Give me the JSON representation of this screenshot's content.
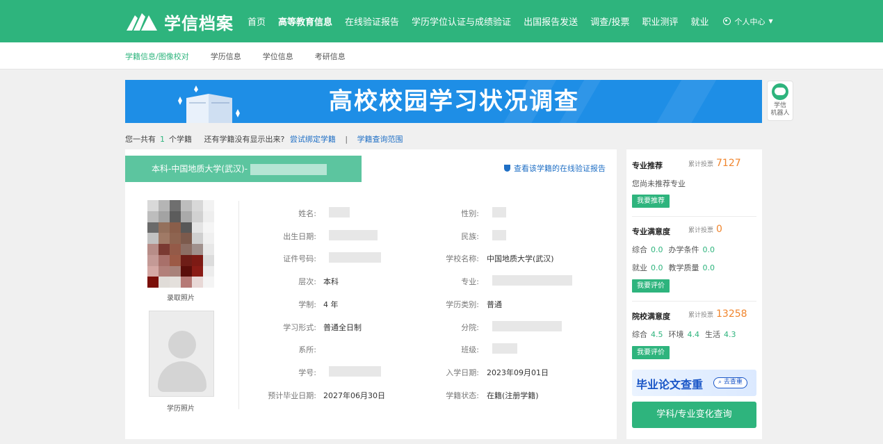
{
  "brand": {
    "name": "学信档案"
  },
  "nav": {
    "items": [
      {
        "label": "首页",
        "active": false
      },
      {
        "label": "高等教育信息",
        "active": true
      },
      {
        "label": "在线验证报告",
        "active": false
      },
      {
        "label": "学历学位认证与成绩验证",
        "active": false
      },
      {
        "label": "出国报告发送",
        "active": false
      },
      {
        "label": "调查/投票",
        "active": false
      },
      {
        "label": "职业测评",
        "active": false
      },
      {
        "label": "就业",
        "active": false
      }
    ],
    "user_center": "个人中心"
  },
  "subnav": {
    "items": [
      {
        "label": "学籍信息/图像校对",
        "active": true
      },
      {
        "label": "学历信息",
        "active": false
      },
      {
        "label": "学位信息",
        "active": false
      },
      {
        "label": "考研信息",
        "active": false
      }
    ]
  },
  "banner": {
    "title": "高校校园学习状况调查"
  },
  "robot": {
    "label_line1": "学信",
    "label_line2": "机器人"
  },
  "summary": {
    "prefix": "您一共有",
    "count": "1",
    "suffix": "个学籍",
    "missing_text": "还有学籍没有显示出来?",
    "bind_link": "尝试绑定学籍",
    "separator": "|",
    "scope_link": "学籍查询范围"
  },
  "record": {
    "tab_title": "本科-中国地质大学(武汉)-",
    "verify_link": "查看该学籍的在线验证报告",
    "admission_photo_label": "录取照片",
    "degree_photo_label": "学历照片",
    "fields_left": [
      {
        "label": "姓名:",
        "value": ""
      },
      {
        "label": "出生日期:",
        "value": ""
      },
      {
        "label": "证件号码:",
        "value": ""
      },
      {
        "label": "层次:",
        "value": "本科"
      },
      {
        "label": "学制:",
        "value": "4 年"
      },
      {
        "label": "学习形式:",
        "value": "普通全日制"
      },
      {
        "label": "系所:",
        "value": ""
      },
      {
        "label": "学号:",
        "value": ""
      },
      {
        "label": "预计毕业日期:",
        "value": "2027年06月30日"
      }
    ],
    "fields_right": [
      {
        "label": "性别:",
        "value": ""
      },
      {
        "label": "民族:",
        "value": ""
      },
      {
        "label": "学校名称:",
        "value": "中国地质大学(武汉)"
      },
      {
        "label": "专业:",
        "value": ""
      },
      {
        "label": "学历类别:",
        "value": "普通"
      },
      {
        "label": "分院:",
        "value": ""
      },
      {
        "label": "班级:",
        "value": ""
      },
      {
        "label": "入学日期:",
        "value": "2023年09月01日"
      },
      {
        "label": "学籍状态:",
        "value": "在籍(注册学籍)"
      }
    ]
  },
  "sidebar": {
    "major_recommend": {
      "title": "专业推荐",
      "votes_label": "累计投票",
      "votes": "7127",
      "text": "您尚未推荐专业",
      "button": "我要推荐"
    },
    "major_satisfaction": {
      "title": "专业满意度",
      "votes_label": "累计投票",
      "votes": "0",
      "scores": [
        {
          "label": "综合",
          "value": "0.0"
        },
        {
          "label": "办学条件",
          "value": "0.0"
        },
        {
          "label": "就业",
          "value": "0.0"
        },
        {
          "label": "教学质量",
          "value": "0.0"
        }
      ],
      "button": "我要评价"
    },
    "school_satisfaction": {
      "title": "院校满意度",
      "votes_label": "累计投票",
      "votes": "13258",
      "scores": [
        {
          "label": "综合",
          "value": "4.5"
        },
        {
          "label": "环境",
          "value": "4.4"
        },
        {
          "label": "生活",
          "value": "4.3"
        }
      ],
      "button": "我要评价"
    },
    "thesis_ad": {
      "title": "毕业论文查重",
      "search": "去查重"
    },
    "change_query": "学科/专业变化查询"
  },
  "colors": {
    "brand_green": "#2eb47d",
    "tab_green": "#5cc59f",
    "banner_blue": "#1e8ee6",
    "link_blue": "#1f6fc5",
    "vote_orange": "#f0852d"
  }
}
